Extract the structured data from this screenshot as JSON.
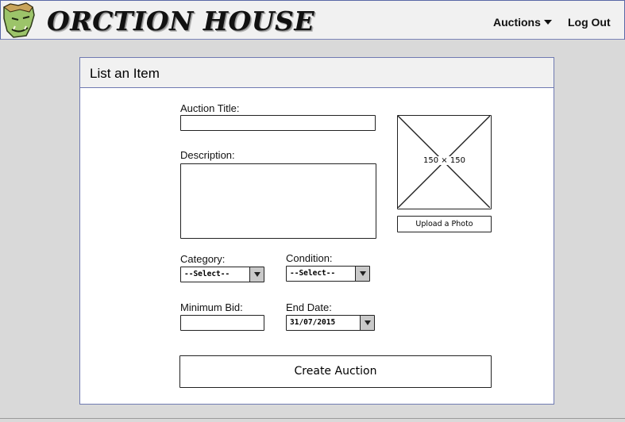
{
  "header": {
    "brand": "ORCTION HOUSE",
    "logo_icon": "orc-face-icon",
    "nav": {
      "auctions_label": "Auctions",
      "logout_label": "Log Out"
    }
  },
  "panel": {
    "title": "List an Item",
    "form": {
      "auction_title_label": "Auction Title:",
      "auction_title_value": "",
      "description_label": "Description:",
      "description_value": "",
      "category_label": "Category:",
      "category_value": "--Select--",
      "condition_label": "Condition:",
      "condition_value": "--Select--",
      "minimum_bid_label": "Minimum Bid:",
      "minimum_bid_value": "",
      "end_date_label": "End Date:",
      "end_date_value": "31/07/2015",
      "image_placeholder_text": "150 × 150",
      "upload_label": "Upload a Photo",
      "submit_label": "Create Auction"
    }
  }
}
